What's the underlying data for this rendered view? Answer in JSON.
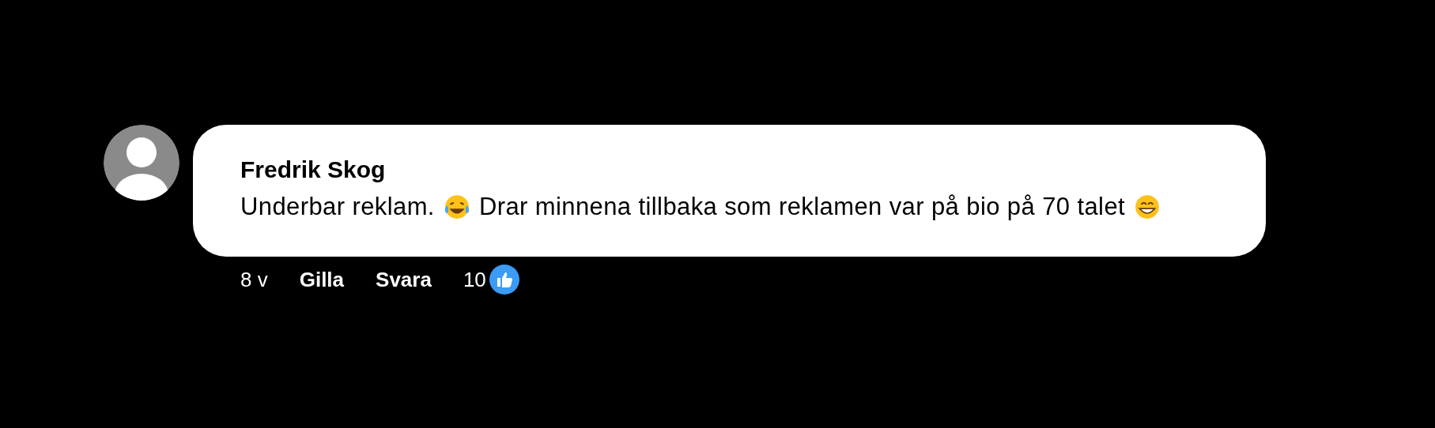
{
  "comment": {
    "author": "Fredrik Skog",
    "body": [
      {
        "kind": "text",
        "text": "Underbar reklam."
      },
      {
        "kind": "laugh"
      },
      {
        "kind": "text",
        "text": "Drar minnena tillbaka som reklamen var på bio på 70 talet"
      },
      {
        "kind": "grin"
      }
    ],
    "time": "8 v",
    "actions": [
      "Gilla",
      "Svara"
    ],
    "like_count": "10"
  }
}
